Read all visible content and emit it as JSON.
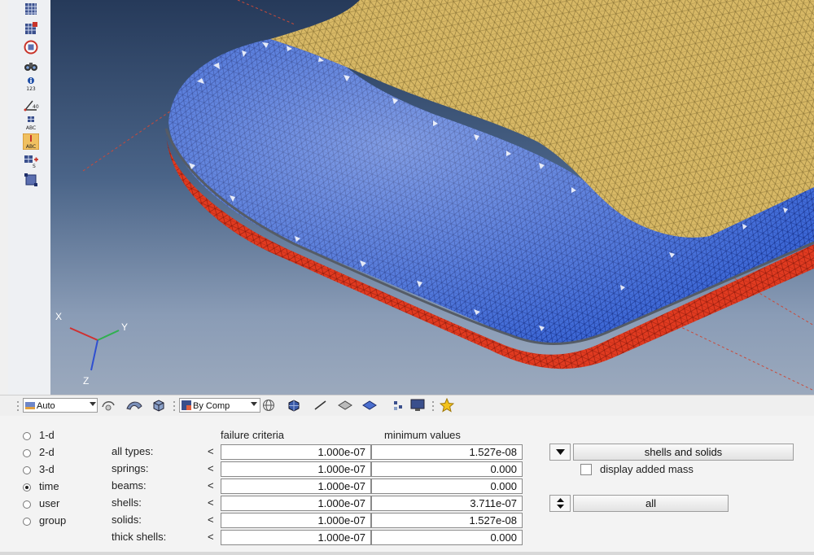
{
  "toolbar": {
    "display_mode": "Auto",
    "color_mode": "By Comp"
  },
  "axis": {
    "x": "X",
    "y": "Y",
    "z": "Z"
  },
  "panel": {
    "radio_options": [
      "1-d",
      "2-d",
      "3-d",
      "time",
      "user",
      "group"
    ],
    "selected": "time",
    "headers": {
      "failure": "failure criteria",
      "minimum": "minimum values"
    },
    "rows": [
      {
        "label": "all types:",
        "op": "<",
        "failure": "1.000e-07",
        "minimum": "1.527e-08"
      },
      {
        "label": "springs:",
        "op": "<",
        "failure": "1.000e-07",
        "minimum": "0.000"
      },
      {
        "label": "beams:",
        "op": "<",
        "failure": "1.000e-07",
        "minimum": "0.000"
      },
      {
        "label": "shells:",
        "op": "<",
        "failure": "1.000e-07",
        "minimum": "3.711e-07"
      },
      {
        "label": "solids:",
        "op": "<",
        "failure": "1.000e-07",
        "minimum": "1.527e-08"
      },
      {
        "label": "thick shells:",
        "op": "<",
        "failure": "1.000e-07",
        "minimum": "0.000"
      }
    ],
    "element_type_button": "shells and solids",
    "display_added_mass": "display added mass",
    "selection_button": "all"
  },
  "colors": {
    "mesh_tan": "#d7b865",
    "mesh_blue": "#3c67d6",
    "mesh_red": "#e03a20"
  }
}
